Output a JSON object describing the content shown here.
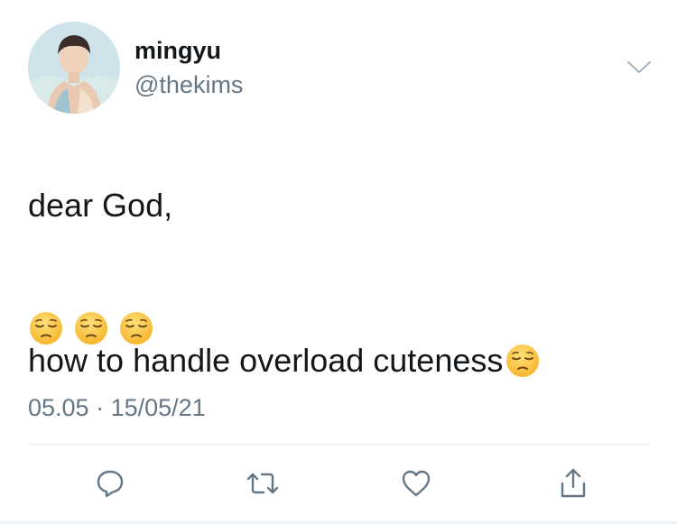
{
  "tweet": {
    "author": {
      "display_name": "mingyu",
      "handle": "@thekims",
      "avatar_icon": "profile-photo"
    },
    "text_line_1": "dear God,",
    "text_line_2": "how to handle overload cuteness",
    "emoji": "pensive-face",
    "emoji_count_after_text": 1,
    "emoji_row_count": 3,
    "time": "05.05",
    "separator": "·",
    "date": "15/05/21",
    "actions": {
      "reply_icon": "reply-icon",
      "retweet_icon": "retweet-icon",
      "like_icon": "like-icon",
      "share_icon": "share-icon"
    },
    "menu_icon": "chevron-down-icon"
  },
  "colors": {
    "text": "#14171a",
    "secondary": "#657786",
    "icon": "#657786",
    "divider": "#e1e8ed",
    "emoji_face": "#ffc83d"
  }
}
